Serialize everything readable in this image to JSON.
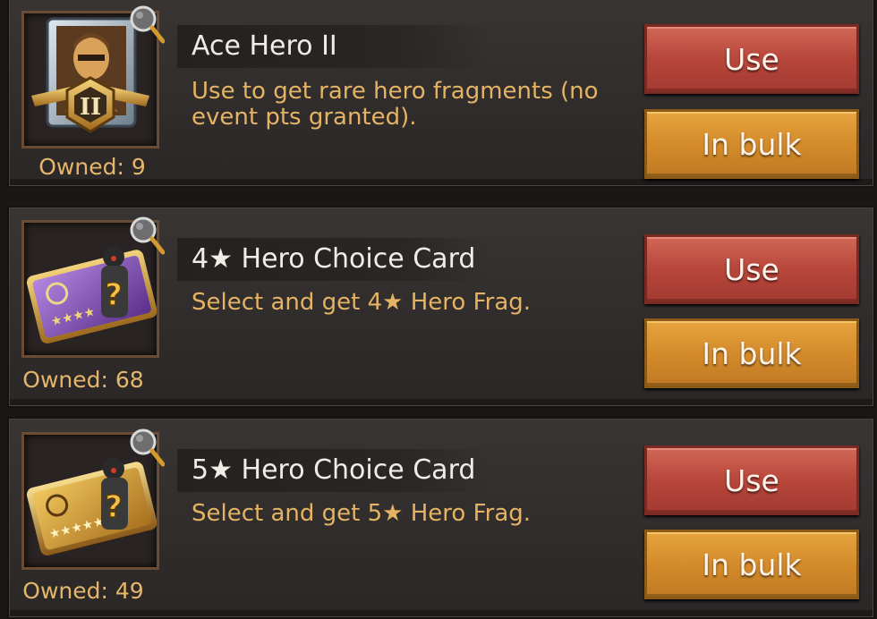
{
  "items": [
    {
      "title": "Ace Hero II",
      "description": "Use to get rare hero fragments (no event pts granted).",
      "owned_label": "Owned: 9",
      "icon": "ace-hero-medal-icon",
      "use_label": "Use",
      "bulk_label": "In bulk"
    },
    {
      "title": "4★ Hero Choice Card",
      "description": "Select and get 4★ Hero Frag.",
      "owned_label": "Owned: 68",
      "icon": "hero-choice-card-purple-icon",
      "use_label": "Use",
      "bulk_label": "In bulk"
    },
    {
      "title": "5★ Hero Choice Card",
      "description": "Select and get 5★ Hero Frag.",
      "owned_label": "Owned: 49",
      "icon": "hero-choice-card-gold-icon",
      "use_label": "Use",
      "bulk_label": "In bulk"
    }
  ],
  "colors": {
    "use_button": "#b8463b",
    "bulk_button": "#d48b2b",
    "title_text": "#f2ece6",
    "desc_text": "#e4b363"
  }
}
